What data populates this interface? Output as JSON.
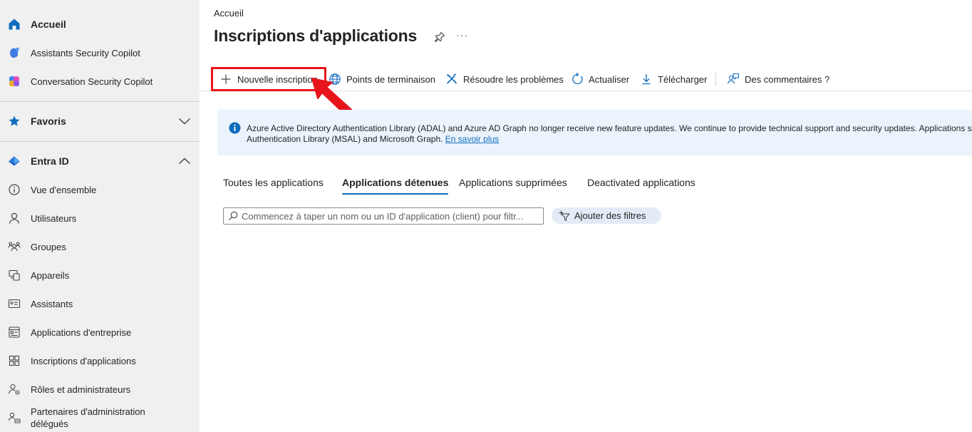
{
  "sidebar": {
    "items": [
      {
        "label": "Accueil",
        "icon": "home-icon"
      },
      {
        "label": "Assistants Security Copilot",
        "icon": "security-copilot-icon"
      },
      {
        "label": "Conversation Security Copilot",
        "icon": "copilot-chat-icon"
      },
      {
        "label": "Favoris",
        "icon": "star-icon"
      },
      {
        "label": "Entra ID",
        "icon": "entra-id-icon"
      },
      {
        "label": "Vue d'ensemble",
        "icon": "info-icon"
      },
      {
        "label": "Utilisateurs",
        "icon": "user-icon"
      },
      {
        "label": "Groupes",
        "icon": "groups-icon"
      },
      {
        "label": "Appareils",
        "icon": "devices-icon"
      },
      {
        "label": "Assistants",
        "icon": "id-card-icon"
      },
      {
        "label": "Applications d'entreprise",
        "icon": "enterprise-apps-icon"
      },
      {
        "label": "Inscriptions d'applications",
        "icon": "app-registrations-icon"
      },
      {
        "label": "Rôles et administrateurs",
        "icon": "roles-icon"
      },
      {
        "label": "Partenaires d'administration délégués",
        "icon": "partners-icon"
      }
    ]
  },
  "header": {
    "breadcrumb": "Accueil",
    "title": "Inscriptions d'applications",
    "more": "···"
  },
  "toolbar": {
    "new_registration": "Nouvelle inscription",
    "endpoints": "Points de terminaison",
    "troubleshoot": "Résoudre les problèmes",
    "refresh": "Actualiser",
    "download": "Télécharger",
    "feedback": "Des commentaires ?"
  },
  "info": {
    "line1": "Azure Active Directory Authentication Library (ADAL) and Azure AD Graph no longer receive new feature updates. We continue to provide technical support and security updates. Applications sh",
    "line2": "Authentication Library (MSAL) and Microsoft Graph. ",
    "link": "En savoir plus"
  },
  "tabs": [
    {
      "label": "Toutes les applications",
      "active": false
    },
    {
      "label": "Applications détenues",
      "active": true
    },
    {
      "label": "Applications supprimées",
      "active": false
    },
    {
      "label": "Deactivated applications",
      "active": false
    }
  ],
  "search": {
    "placeholder": "Commencez à taper un nom ou un ID d'application (client) pour filtr...",
    "value": ""
  },
  "filter": {
    "label": "Ajouter des filtres"
  },
  "colors": {
    "accent": "#0f6cbd",
    "highlight": "#e8141b",
    "sidebar_bg": "#f0f0f0",
    "info_bg": "#ebf3fc"
  }
}
